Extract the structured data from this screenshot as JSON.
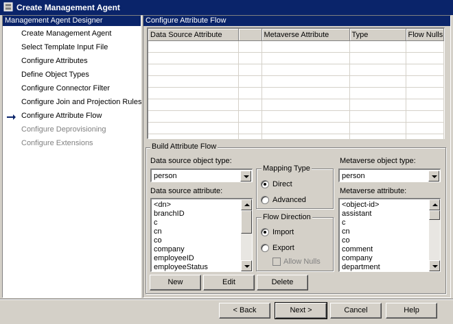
{
  "window": {
    "title": "Create Management Agent"
  },
  "sidebar": {
    "header": "Management Agent Designer",
    "items": [
      {
        "label": "Create Management Agent",
        "state": "enabled"
      },
      {
        "label": "Select Template Input File",
        "state": "enabled"
      },
      {
        "label": "Configure Attributes",
        "state": "enabled"
      },
      {
        "label": "Define Object Types",
        "state": "enabled"
      },
      {
        "label": "Configure Connector Filter",
        "state": "enabled"
      },
      {
        "label": "Configure Join and Projection Rules",
        "state": "enabled"
      },
      {
        "label": "Configure Attribute Flow",
        "state": "current"
      },
      {
        "label": "Configure Deprovisioning",
        "state": "disabled"
      },
      {
        "label": "Configure Extensions",
        "state": "disabled"
      }
    ]
  },
  "main": {
    "header": "Configure Attribute Flow",
    "grid": {
      "columns": [
        "Data Source Attribute",
        "",
        "Metaverse Attribute",
        "Type",
        "Flow Nulls"
      ],
      "rows": []
    },
    "build": {
      "group_label": "Build Attribute Flow",
      "ds_object_type_label": "Data source object type:",
      "ds_object_type_value": "person",
      "ds_attribute_label": "Data source attribute:",
      "ds_attributes": [
        "<dn>",
        "branchID",
        "c",
        "cn",
        "co",
        "company",
        "employeeID",
        "employeeStatus"
      ],
      "mapping_type": {
        "label": "Mapping Type",
        "direct": "Direct",
        "advanced": "Advanced",
        "selected": "direct"
      },
      "flow_direction": {
        "label": "Flow Direction",
        "import": "Import",
        "export": "Export",
        "allow_nulls": "Allow Nulls",
        "selected": "import"
      },
      "mv_object_type_label": "Metaverse object type:",
      "mv_object_type_value": "person",
      "mv_attribute_label": "Metaverse attribute:",
      "mv_attributes": [
        "<object-id>",
        "assistant",
        "c",
        "cn",
        "co",
        "comment",
        "company",
        "department"
      ],
      "buttons": {
        "new": "New",
        "edit": "Edit",
        "delete": "Delete"
      }
    }
  },
  "footer": {
    "back": "< Back",
    "next": "Next >",
    "cancel": "Cancel",
    "help": "Help"
  }
}
